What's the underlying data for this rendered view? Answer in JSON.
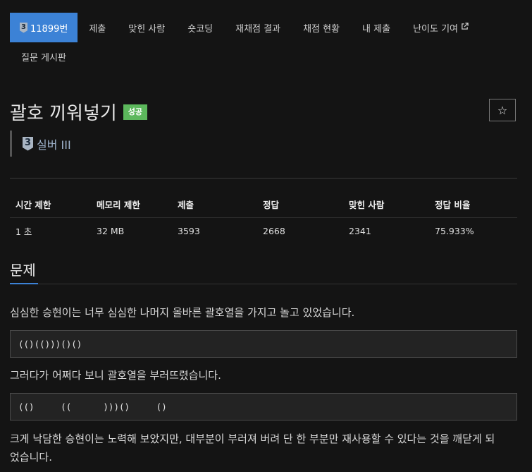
{
  "nav": {
    "problem_tab": {
      "tier": "3",
      "label": "11899번"
    },
    "items": [
      "제출",
      "맞힌 사람",
      "숏코딩",
      "재채점 결과",
      "채점 현황",
      "내 제출",
      "난이도 기여"
    ],
    "row2": [
      "질문 게시판"
    ]
  },
  "problem": {
    "title": "괄호 끼워넣기",
    "status_badge": "성공",
    "star_icon": "☆",
    "tier_label": "실버 III",
    "tier_number": "3"
  },
  "stats": {
    "headers": [
      "시간 제한",
      "메모리 제한",
      "제출",
      "정답",
      "맞힌 사람",
      "정답 비율"
    ],
    "values": [
      "1 초",
      "32 MB",
      "3593",
      "2668",
      "2341",
      "75.933%"
    ]
  },
  "section": {
    "title": "문제"
  },
  "content": {
    "p1": "심심한 승현이는 너무 심심한 나머지 올바른 괄호열을 가지고 놀고 있었습니다.",
    "code1": "(()(()))()()",
    "p2": "그러다가 어쩌다 보니 괄호열을 부러뜨렸습니다.",
    "code2": "(()     ((      )))()     ()",
    "p3_line1": "크게 낙담한 승현이는 노력해 보았지만, 대부분이 부러져 버려 단 한 부분만 재사용할 수 있다는 것을 깨닫게 되",
    "p3_line2": "었습니다."
  },
  "colors": {
    "accent": "#3c82d6",
    "success": "#5cb85c",
    "tier": "#9fb3cc"
  },
  "icons": {
    "external_link": "external-link-icon",
    "star": "star-icon",
    "tier": "silver-tier-icon"
  }
}
